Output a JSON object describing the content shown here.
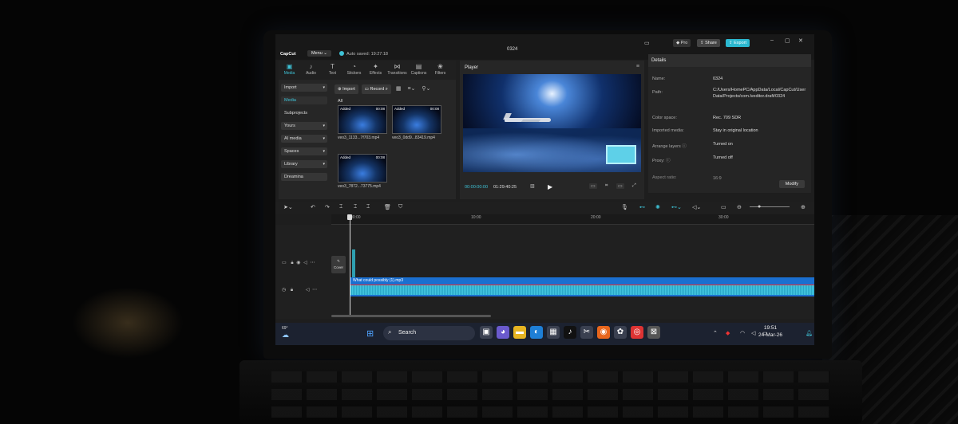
{
  "titlebar": {
    "logo": "CapCut",
    "menu": "Menu ⌄",
    "autosave": "Auto saved: 19:27:18",
    "project_title": "0324",
    "pro": "Pro",
    "share": "Share",
    "export": "Export",
    "minimize": "–",
    "maximize": "▢",
    "close": "✕"
  },
  "media_tabs": [
    {
      "label": "Media",
      "icon": "▣"
    },
    {
      "label": "Audio",
      "icon": "♪"
    },
    {
      "label": "Text",
      "icon": "T"
    },
    {
      "label": "Stickers",
      "icon": "◔"
    },
    {
      "label": "Effects",
      "icon": "✦"
    },
    {
      "label": "Transitions",
      "icon": "⋈"
    },
    {
      "label": "Captions",
      "icon": "▤"
    },
    {
      "label": "Filters",
      "icon": "❀"
    }
  ],
  "sidenav": {
    "import": "Import",
    "media": "Media",
    "subprojects": "Subprojects",
    "yours": "Yours",
    "ai_media": "AI media",
    "spaces": "Spaces",
    "library": "Library",
    "dreamina": "Dreamina"
  },
  "media_toolbar": {
    "import": "Import",
    "record": "Record"
  },
  "all_label": "All",
  "clips": [
    {
      "badge": "Added",
      "duration": "00:08",
      "name": "veo3_1133...7f703.mp4"
    },
    {
      "badge": "Added",
      "duration": "00:08",
      "name": "veo3_0dd9...83419.mp4"
    },
    {
      "badge": "Added",
      "duration": "00:08",
      "name": "veo3_7872...73775.mp4"
    }
  ],
  "player": {
    "title": "Player",
    "current_time": "00:00:00:00",
    "total_time": "01:29:40:25"
  },
  "details": {
    "title": "Details",
    "name_label": "Name:",
    "name_value": "0324",
    "path_label": "Path:",
    "path_value": "C:/Users/HomePC/AppData/Local/CapCut/User Data/Projects/com.lveditor.draft/0324",
    "color_label": "Color space:",
    "color_value": "Rec. 709 SDR",
    "imported_label": "Imported media:",
    "imported_value": "Stay in original location",
    "arrange_label": "Arrange layers ⓘ",
    "arrange_value": "Turned on",
    "proxy_label": "Proxy: ⓘ",
    "proxy_value": "Turned off",
    "aspect_label": "Aspect ratio:",
    "aspect_value": "16:9",
    "modify": "Modify"
  },
  "ruler": {
    "t0": "00:00",
    "t1": "10:00",
    "t2": "20:00",
    "t3": "30:00"
  },
  "timeline": {
    "cover": "Cover",
    "audio_clip": "What could possibly (1).mp3"
  },
  "taskbar": {
    "weather": "69°",
    "search": "Search",
    "time": "19:51",
    "date": "24-Mar-26"
  },
  "colors": {
    "accent": "#3ec2d6",
    "export": "#2bb8d0",
    "audio_clip": "#1a6fd0"
  }
}
